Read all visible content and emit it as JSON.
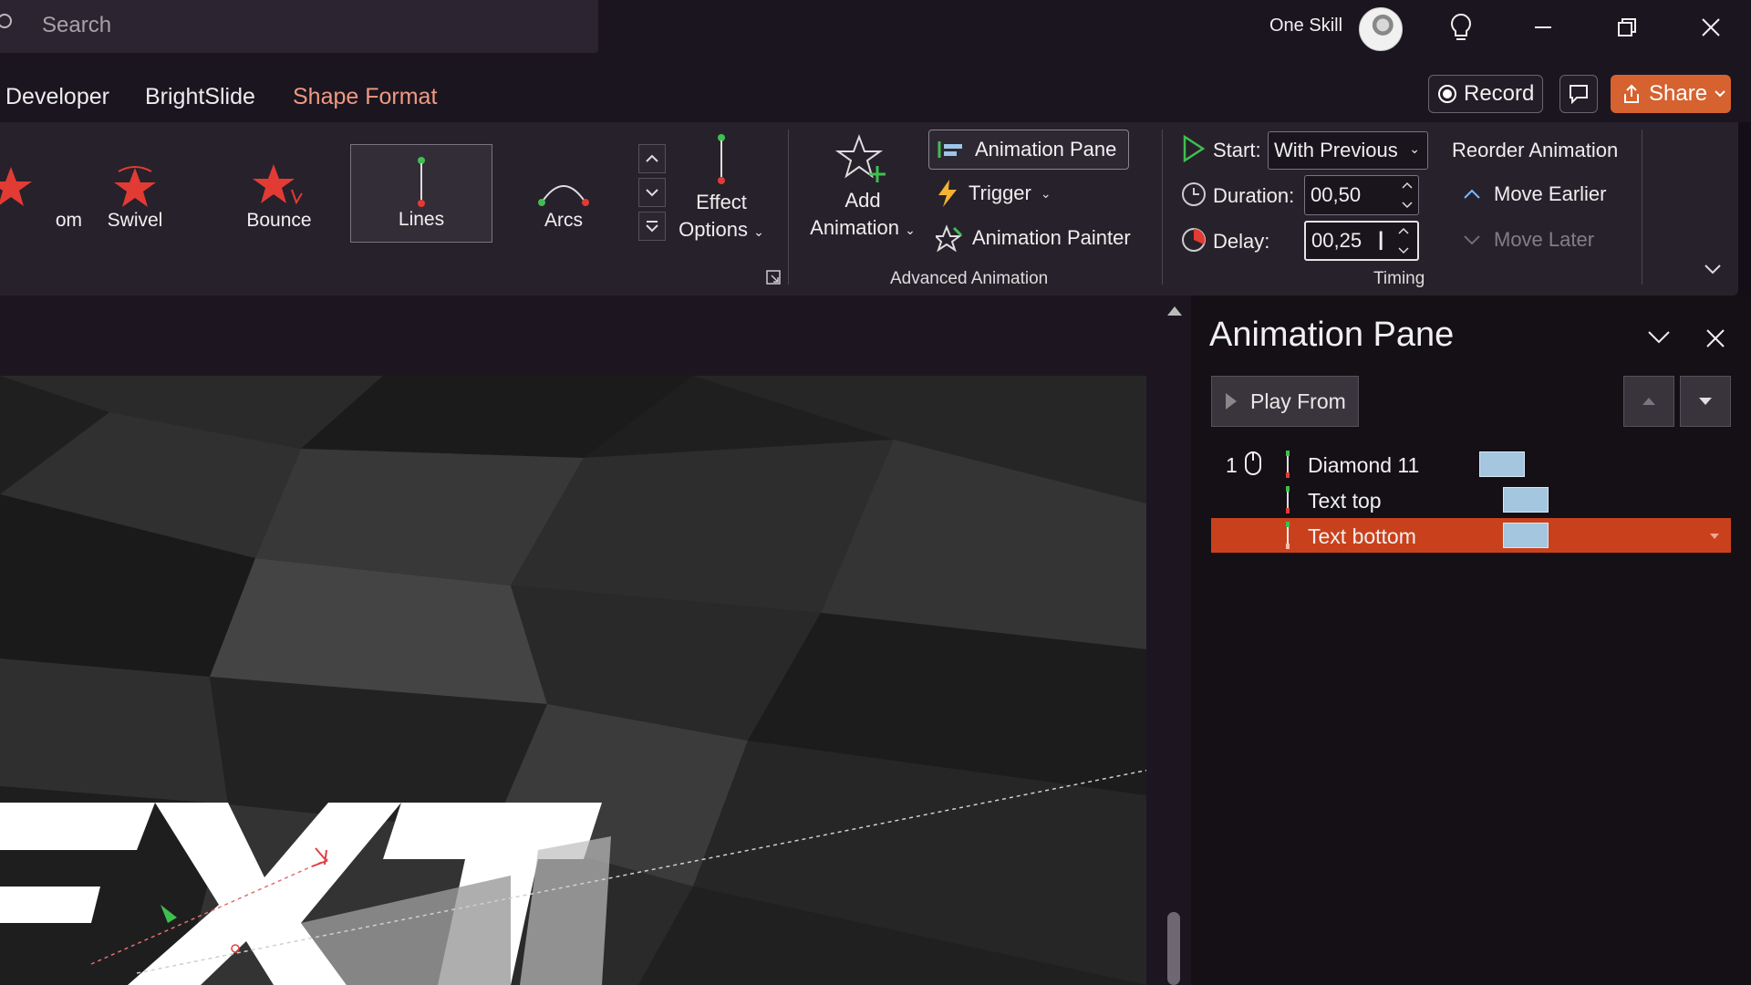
{
  "search": {
    "placeholder": "Search"
  },
  "account": {
    "name": "One Skill"
  },
  "tabs": [
    {
      "label": "Developer"
    },
    {
      "label": "BrightSlide"
    },
    {
      "label": "Shape Format",
      "active_color": "#ef9a80"
    }
  ],
  "header_buttons": {
    "record": "Record",
    "share": "Share"
  },
  "gallery": {
    "items": [
      {
        "label": "om"
      },
      {
        "label": "Swivel"
      },
      {
        "label": "Bounce"
      },
      {
        "label": "Lines",
        "selected": true
      },
      {
        "label": "Arcs"
      }
    ]
  },
  "effect_options": {
    "line1": "Effect",
    "line2": "Options"
  },
  "add_animation": {
    "line1": "Add",
    "line2": "Animation"
  },
  "advanced_animation": {
    "animation_pane": "Animation Pane",
    "trigger": "Trigger",
    "animation_painter": "Animation Painter",
    "group_label": "Advanced Animation"
  },
  "timing": {
    "start_label": "Start:",
    "start_value": "With Previous",
    "duration_label": "Duration:",
    "duration_value": "00,50",
    "delay_label": "Delay:",
    "delay_value": "00,25",
    "group_label": "Timing"
  },
  "reorder": {
    "title": "Reorder Animation",
    "move_earlier": "Move Earlier",
    "move_later": "Move Later"
  },
  "animation_pane": {
    "title": "Animation Pane",
    "play_from": "Play From",
    "items": [
      {
        "number": "1",
        "name": "Diamond 11",
        "bar_start": 0.0,
        "selected": false
      },
      {
        "number": "",
        "name": "Text top",
        "bar_start": 0.05,
        "selected": false
      },
      {
        "number": "",
        "name": "Text bottom",
        "bar_start": 0.05,
        "selected": true
      }
    ]
  },
  "colors": {
    "accent": "#d5622f",
    "selected_row": "#c9411c",
    "timeline_bar": "#a4c6df",
    "effect_star": "#e23b34"
  }
}
